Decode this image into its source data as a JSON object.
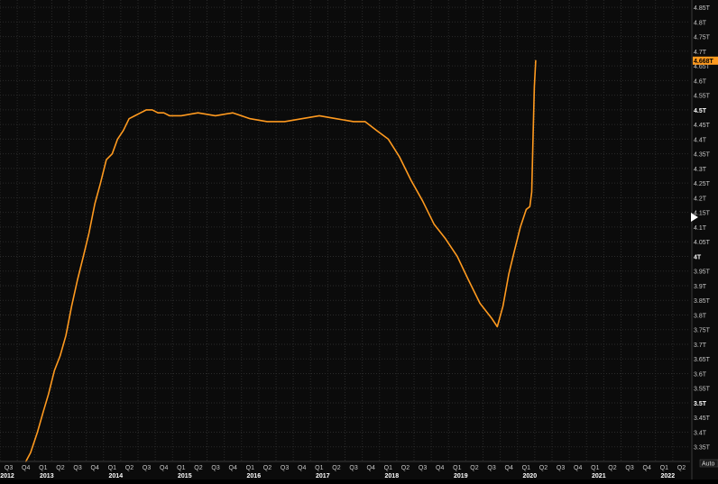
{
  "chart_data": {
    "type": "line",
    "title": "",
    "xlabel": "",
    "ylabel": "",
    "grid": true,
    "legend": "none",
    "colors": {
      "line": "#ff9a1f",
      "background": "#0b0b0b",
      "grid": "#2b2b2b",
      "axis_text": "#c9c9c9",
      "price_tag": "#ff9a1f"
    },
    "ylim": [
      3.3,
      4.875
    ],
    "y_ticks": [
      {
        "value": 4.85,
        "label": "4.85T",
        "bold": false
      },
      {
        "value": 4.8,
        "label": "4.8T",
        "bold": false
      },
      {
        "value": 4.75,
        "label": "4.75T",
        "bold": false
      },
      {
        "value": 4.7,
        "label": "4.7T",
        "bold": false
      },
      {
        "value": 4.65,
        "label": "4.65T",
        "bold": false
      },
      {
        "value": 4.6,
        "label": "4.6T",
        "bold": false
      },
      {
        "value": 4.55,
        "label": "4.55T",
        "bold": false
      },
      {
        "value": 4.5,
        "label": "4.5T",
        "bold": true
      },
      {
        "value": 4.45,
        "label": "4.45T",
        "bold": false
      },
      {
        "value": 4.4,
        "label": "4.4T",
        "bold": false
      },
      {
        "value": 4.35,
        "label": "4.35T",
        "bold": false
      },
      {
        "value": 4.3,
        "label": "4.3T",
        "bold": false
      },
      {
        "value": 4.25,
        "label": "4.25T",
        "bold": false
      },
      {
        "value": 4.2,
        "label": "4.2T",
        "bold": false
      },
      {
        "value": 4.15,
        "label": "4.15T",
        "bold": false
      },
      {
        "value": 4.1,
        "label": "4.1T",
        "bold": false
      },
      {
        "value": 4.05,
        "label": "4.05T",
        "bold": false
      },
      {
        "value": 4.0,
        "label": "4T",
        "bold": true
      },
      {
        "value": 3.95,
        "label": "3.95T",
        "bold": false
      },
      {
        "value": 3.9,
        "label": "3.9T",
        "bold": false
      },
      {
        "value": 3.85,
        "label": "3.85T",
        "bold": false
      },
      {
        "value": 3.8,
        "label": "3.8T",
        "bold": false
      },
      {
        "value": 3.75,
        "label": "3.75T",
        "bold": false
      },
      {
        "value": 3.7,
        "label": "3.7T",
        "bold": false
      },
      {
        "value": 3.65,
        "label": "3.65T",
        "bold": false
      },
      {
        "value": 3.6,
        "label": "3.6T",
        "bold": false
      },
      {
        "value": 3.55,
        "label": "3.55T",
        "bold": false
      },
      {
        "value": 3.5,
        "label": "3.5T",
        "bold": true
      },
      {
        "value": 3.45,
        "label": "3.45T",
        "bold": false
      },
      {
        "value": 3.4,
        "label": "3.4T",
        "bold": false
      },
      {
        "value": 3.35,
        "label": "3.35T",
        "bold": false
      }
    ],
    "x_quarter_labels": [
      "Q3",
      "Q4",
      "Q1",
      "Q2",
      "Q3",
      "Q4",
      "Q1",
      "Q2",
      "Q3",
      "Q4",
      "Q1",
      "Q2",
      "Q3",
      "Q4",
      "Q1",
      "Q2",
      "Q3",
      "Q4",
      "Q1",
      "Q2",
      "Q3",
      "Q4",
      "Q1",
      "Q2",
      "Q3",
      "Q4",
      "Q1",
      "Q2",
      "Q3",
      "Q4",
      "Q1",
      "Q2",
      "Q3",
      "Q4",
      "Q1",
      "Q2",
      "Q3",
      "Q4",
      "Q1",
      "Q2"
    ],
    "x_year_labels": [
      "2012",
      "2013",
      "2014",
      "2015",
      "2016",
      "2017",
      "2018",
      "2019",
      "2020",
      "2021",
      "2022"
    ],
    "last_value_label": "4.668T",
    "autoscale_label": "Auto",
    "series": [
      {
        "values": [
          {
            "x": "2012-11-15",
            "y": 3.3
          },
          {
            "x": "2012-12-10",
            "y": 3.33
          },
          {
            "x": "2013-01-15",
            "y": 3.4
          },
          {
            "x": "2013-02-15",
            "y": 3.47
          },
          {
            "x": "2013-03-15",
            "y": 3.53
          },
          {
            "x": "2013-04-15",
            "y": 3.61
          },
          {
            "x": "2013-05-15",
            "y": 3.66
          },
          {
            "x": "2013-06-15",
            "y": 3.73
          },
          {
            "x": "2013-07-15",
            "y": 3.83
          },
          {
            "x": "2013-08-15",
            "y": 3.92
          },
          {
            "x": "2013-09-15",
            "y": 4.0
          },
          {
            "x": "2013-10-15",
            "y": 4.08
          },
          {
            "x": "2013-11-15",
            "y": 4.18
          },
          {
            "x": "2013-12-15",
            "y": 4.25
          },
          {
            "x": "2014-01-15",
            "y": 4.33
          },
          {
            "x": "2014-02-15",
            "y": 4.35
          },
          {
            "x": "2014-03-15",
            "y": 4.4
          },
          {
            "x": "2014-04-15",
            "y": 4.43
          },
          {
            "x": "2014-05-15",
            "y": 4.47
          },
          {
            "x": "2014-06-15",
            "y": 4.48
          },
          {
            "x": "2014-07-15",
            "y": 4.49
          },
          {
            "x": "2014-08-15",
            "y": 4.5
          },
          {
            "x": "2014-09-15",
            "y": 4.5
          },
          {
            "x": "2014-10-15",
            "y": 4.49
          },
          {
            "x": "2014-11-15",
            "y": 4.49
          },
          {
            "x": "2014-12-15",
            "y": 4.48
          },
          {
            "x": "2015-02-15",
            "y": 4.48
          },
          {
            "x": "2015-05-15",
            "y": 4.49
          },
          {
            "x": "2015-08-15",
            "y": 4.48
          },
          {
            "x": "2015-11-15",
            "y": 4.49
          },
          {
            "x": "2016-02-15",
            "y": 4.47
          },
          {
            "x": "2016-05-15",
            "y": 4.46
          },
          {
            "x": "2016-08-15",
            "y": 4.46
          },
          {
            "x": "2016-11-15",
            "y": 4.47
          },
          {
            "x": "2017-02-15",
            "y": 4.48
          },
          {
            "x": "2017-05-15",
            "y": 4.47
          },
          {
            "x": "2017-08-15",
            "y": 4.46
          },
          {
            "x": "2017-10-15",
            "y": 4.46
          },
          {
            "x": "2017-12-15",
            "y": 4.43
          },
          {
            "x": "2018-02-15",
            "y": 4.4
          },
          {
            "x": "2018-04-15",
            "y": 4.34
          },
          {
            "x": "2018-06-15",
            "y": 4.26
          },
          {
            "x": "2018-08-15",
            "y": 4.19
          },
          {
            "x": "2018-10-15",
            "y": 4.11
          },
          {
            "x": "2018-12-15",
            "y": 4.06
          },
          {
            "x": "2019-02-15",
            "y": 4.0
          },
          {
            "x": "2019-04-15",
            "y": 3.92
          },
          {
            "x": "2019-06-15",
            "y": 3.84
          },
          {
            "x": "2019-08-15",
            "y": 3.79
          },
          {
            "x": "2019-09-15",
            "y": 3.76
          },
          {
            "x": "2019-10-15",
            "y": 3.83
          },
          {
            "x": "2019-11-15",
            "y": 3.94
          },
          {
            "x": "2019-12-15",
            "y": 4.02
          },
          {
            "x": "2020-01-15",
            "y": 4.1
          },
          {
            "x": "2020-02-15",
            "y": 4.16
          },
          {
            "x": "2020-03-05",
            "y": 4.17
          },
          {
            "x": "2020-03-15",
            "y": 4.22
          },
          {
            "x": "2020-03-22",
            "y": 4.4
          },
          {
            "x": "2020-03-29",
            "y": 4.58
          },
          {
            "x": "2020-04-05",
            "y": 4.668
          }
        ]
      }
    ]
  }
}
